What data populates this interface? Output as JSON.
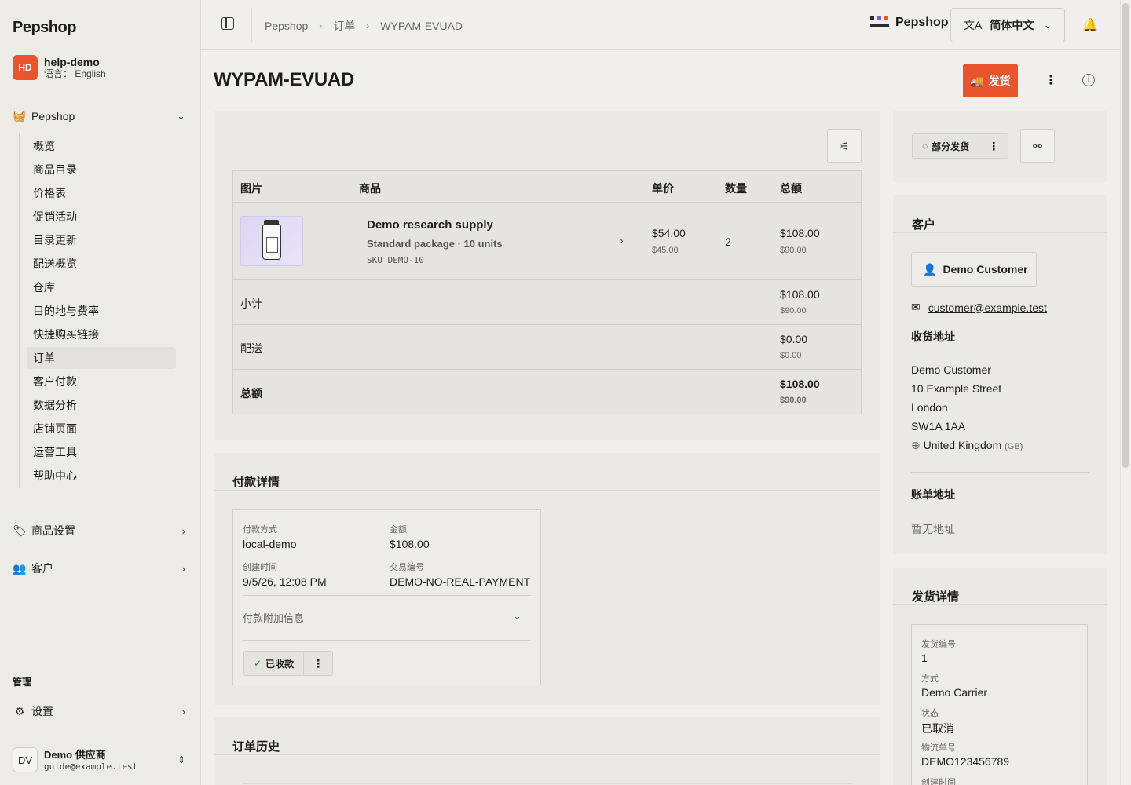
{
  "sidebar": {
    "brand": "Pepshop",
    "account": {
      "initials": "HD",
      "name": "help-demo",
      "language": "语言： English",
      "avatar_color": "#e8542b"
    },
    "store_group": "Pepshop",
    "items": [
      {
        "label": "概览"
      },
      {
        "label": "商品目录"
      },
      {
        "label": "价格表"
      },
      {
        "label": "促销活动"
      },
      {
        "label": "目录更新"
      },
      {
        "label": "配送概览"
      },
      {
        "label": "仓库"
      },
      {
        "label": "目的地与费率"
      },
      {
        "label": "快捷购买链接"
      },
      {
        "label": "订单"
      },
      {
        "label": "客户付款"
      },
      {
        "label": "数据分析"
      },
      {
        "label": "店铺页面"
      },
      {
        "label": "运营工具"
      },
      {
        "label": "帮助中心"
      }
    ],
    "product_settings": "商品设置",
    "customers": "客户",
    "admin_label": "管理",
    "settings": "设置",
    "vendor": {
      "initials": "DV",
      "name": "Demo 供应商",
      "email": "guide@example.test"
    }
  },
  "topbar": {
    "breadcrumb": [
      "Pepshop",
      "订单",
      "WYPAM-EVUAD"
    ],
    "logo_text": "Pepshop",
    "language": "简体中文"
  },
  "page": {
    "title": "WYPAM-EVUAD",
    "ship_button": "发货",
    "accent": "#e8542b"
  },
  "items": {
    "headers": {
      "image": "图片",
      "product": "商品",
      "unit_price": "单价",
      "qty": "数量",
      "total": "总额"
    },
    "line": {
      "name": "Demo research supply",
      "variant": "Standard package · 10 units",
      "sku": "SKU DEMO-10",
      "unit_price": "$54.00",
      "unit_price_sub": "$45.00",
      "qty": "2",
      "total": "$108.00",
      "total_sub": "$90.00"
    },
    "subtotal": {
      "label": "小计",
      "value": "$108.00",
      "sub": "$90.00"
    },
    "shipping": {
      "label": "配送",
      "value": "$0.00",
      "sub": "$0.00"
    },
    "grand": {
      "label": "总额",
      "value": "$108.00",
      "sub": "$90.00"
    }
  },
  "payment": {
    "title": "付款详情",
    "method_label": "付款方式",
    "method": "local-demo",
    "amount_label": "金额",
    "amount": "$108.00",
    "created_label": "创建时间",
    "created": "9/5/26, 12:08 PM",
    "txn_label": "交易编号",
    "txn": "DEMO-NO-REAL-PAYMENT",
    "extra_label": "付款附加信息",
    "status": "已收款"
  },
  "history": {
    "title": "订单历史"
  },
  "fulfillment": {
    "partial_button": "部分发货"
  },
  "customer": {
    "title": "客户",
    "name": "Demo Customer",
    "email": "customer@example.test",
    "shipping_title": "收货地址",
    "address": [
      "Demo Customer",
      "10 Example Street",
      "London",
      "SW1A 1AA"
    ],
    "country": "United Kingdom",
    "country_code": "(GB)",
    "billing_title": "账单地址",
    "billing_empty": "暂无地址"
  },
  "shipment": {
    "title": "发货详情",
    "no_label": "发货编号",
    "no": "1",
    "method_label": "方式",
    "method": "Demo Carrier",
    "status_label": "状态",
    "status": "已取消",
    "tracking_label": "物流单号",
    "tracking": "DEMO123456789",
    "created_label": "创建时间"
  }
}
